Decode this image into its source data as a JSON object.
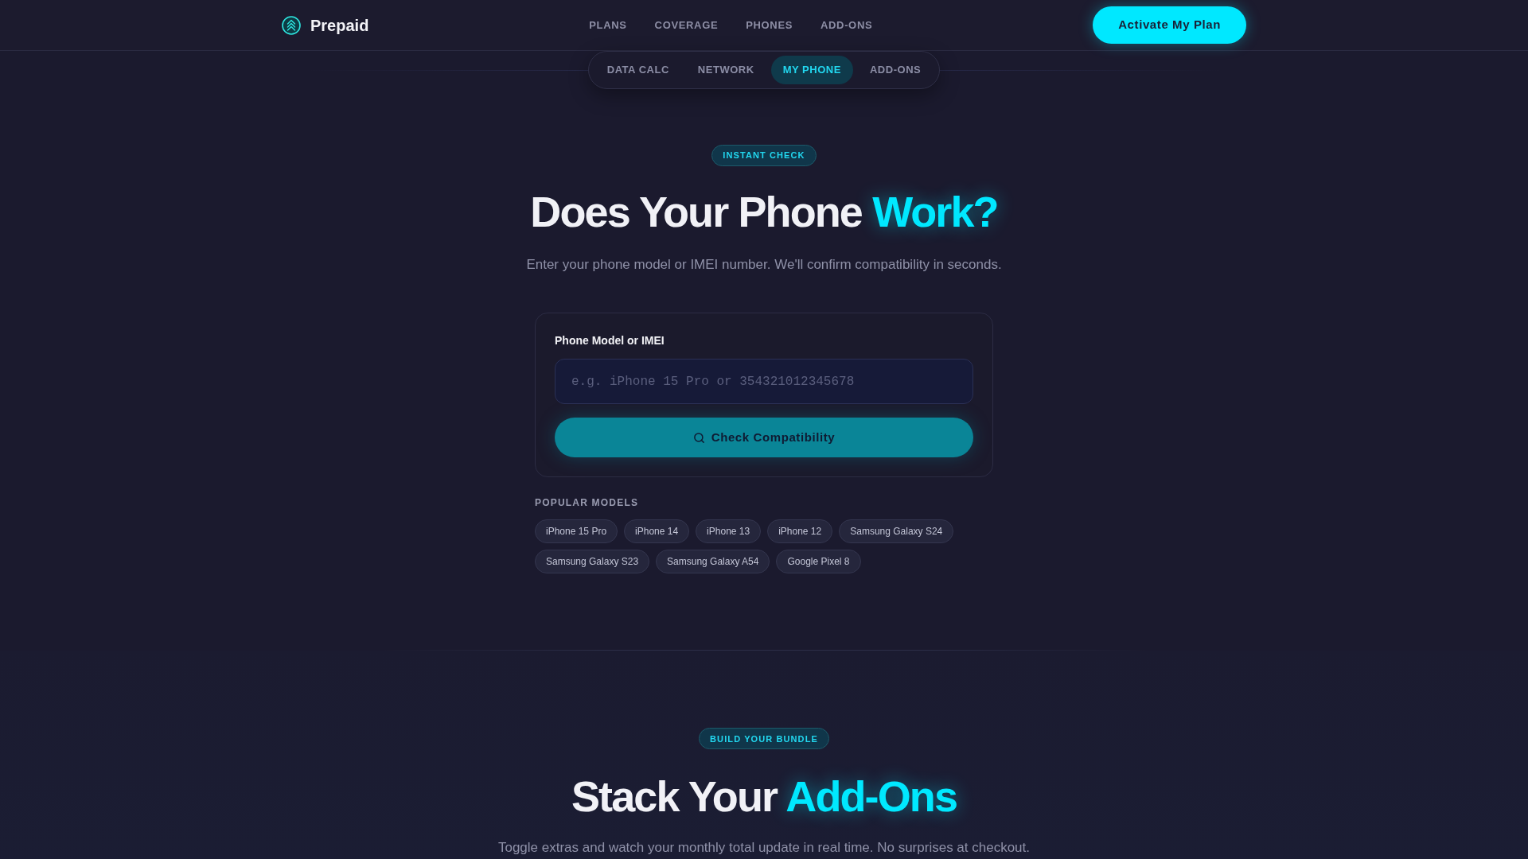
{
  "header": {
    "brand": "Prepaid",
    "nav": [
      "PLANS",
      "COVERAGE",
      "PHONES",
      "ADD-ONS"
    ],
    "cta": "Activate My Plan"
  },
  "subnav": {
    "tabs": [
      {
        "label": "DATA CALC",
        "selected": false
      },
      {
        "label": "NETWORK",
        "selected": false
      },
      {
        "label": "MY PHONE",
        "selected": true
      },
      {
        "label": "ADD-ONS",
        "selected": false
      }
    ]
  },
  "compatibility": {
    "badge": "INSTANT CHECK",
    "title": "Does Your Phone",
    "title_highlight": "Work?",
    "subtitle": "Enter your phone model or IMEI number. We'll confirm compatibility in seconds.",
    "form": {
      "label": "Phone Model or IMEI",
      "input": {
        "placeholder": "e.g. iPhone 15 Pro or 354321012345678"
      },
      "button": "Check Compatibility"
    },
    "popular": {
      "heading": "POPULAR MODELS",
      "models": [
        "iPhone 15 Pro",
        "iPhone 14",
        "iPhone 13",
        "iPhone 12",
        "Samsung Galaxy S24",
        "Samsung Galaxy S23",
        "Samsung Galaxy A54",
        "Google Pixel 8"
      ]
    }
  },
  "addons": {
    "badge": "BUILD YOUR BUNDLE",
    "title": "Stack Your",
    "title_highlight": "Add-Ons",
    "subtitle": "Toggle extras and watch your monthly total update in real time. No surprises at checkout."
  }
}
